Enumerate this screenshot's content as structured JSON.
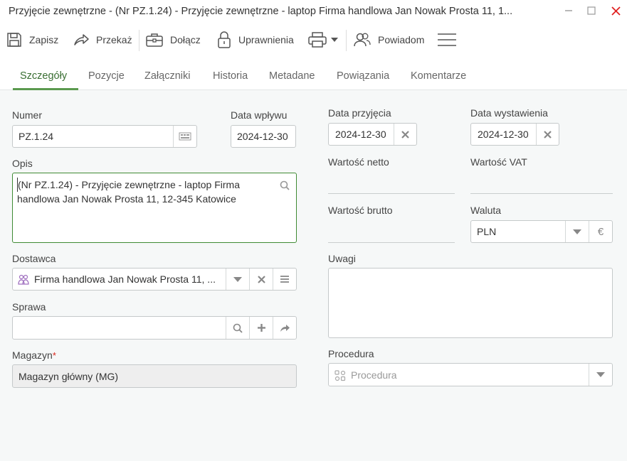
{
  "window": {
    "title": "Przyjęcie zewnętrzne - (Nr PZ.1.24) - Przyjęcie zewnętrzne - laptop Firma handlowa Jan Nowak Prosta 11, 1...",
    "minimize_icon": "minimize-icon",
    "maximize_icon": "maximize-icon",
    "close_icon": "close-icon"
  },
  "toolbar": {
    "save": "Zapisz",
    "forward": "Przekaż",
    "attach": "Dołącz",
    "permissions": "Uprawnienia",
    "print_icon": "printer-icon",
    "notify": "Powiadom",
    "menu_icon": "hamburger-icon"
  },
  "tabs": [
    "Szczegóły",
    "Pozycje",
    "Załączniki",
    "Historia",
    "Metadane",
    "Powiązania",
    "Komentarze"
  ],
  "active_tab": "Szczegóły",
  "form": {
    "numer": {
      "label": "Numer",
      "value": "PZ.1.24"
    },
    "data_wplywu": {
      "label": "Data wpływu",
      "value": "2024-12-30"
    },
    "data_przyjecia": {
      "label": "Data przyjęcia",
      "value": "2024-12-30"
    },
    "data_wystawienia": {
      "label": "Data wystawienia",
      "value": "2024-12-30"
    },
    "opis": {
      "label": "Opis",
      "line1": "(Nr PZ.1.24) - Przyjęcie zewnętrzne - laptop Firma",
      "line2": "handlowa Jan Nowak Prosta 11, 12-345 Katowice"
    },
    "wartosc_netto": {
      "label": "Wartość netto",
      "value": ""
    },
    "wartosc_vat": {
      "label": "Wartość VAT",
      "value": ""
    },
    "wartosc_brutto": {
      "label": "Wartość brutto",
      "value": ""
    },
    "waluta": {
      "label": "Waluta",
      "value": "PLN",
      "symbol": "€"
    },
    "dostawca": {
      "label": "Dostawca",
      "value": "Firma handlowa Jan Nowak Prosta 11, ..."
    },
    "uwagi": {
      "label": "Uwagi",
      "value": ""
    },
    "sprawa": {
      "label": "Sprawa",
      "value": ""
    },
    "magazyn": {
      "label": "Magazyn",
      "required_mark": "*",
      "value": "Magazyn główny (MG)"
    },
    "procedura": {
      "label": "Procedura",
      "placeholder": "Procedura"
    }
  },
  "colors": {
    "accent": "#5b9a4e",
    "required": "#d9261c",
    "close": "#e02020"
  }
}
